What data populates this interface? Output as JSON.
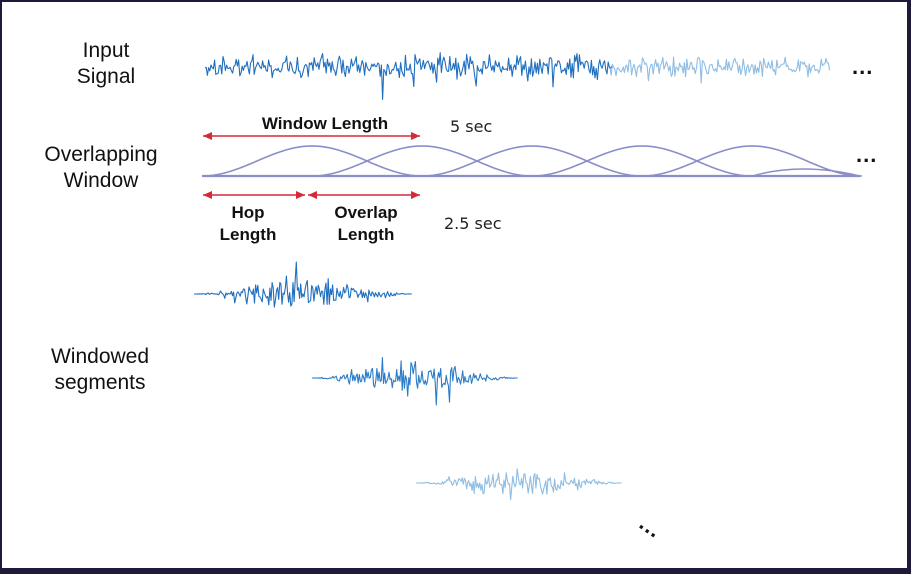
{
  "labels": {
    "input_signal_line1": "Input",
    "input_signal_line2": "Signal",
    "overlapping_window_line1": "Overlapping",
    "overlapping_window_line2": "Window",
    "windowed_segments_line1": "Windowed",
    "windowed_segments_line2": "segments",
    "window_length": "Window Length",
    "hop_length_line1": "Hop",
    "hop_length_line2": "Length",
    "overlap_length_line1": "Overlap",
    "overlap_length_line2": "Length"
  },
  "notes": {
    "window_duration": "5 sec",
    "overlap_duration": "2.5 sec"
  },
  "ellipsis": {
    "signal": "...",
    "window": "...",
    "segments": "..."
  },
  "colors": {
    "signal_dark": "#1f6fbf",
    "signal_light": "#8fbde3",
    "window_curve": "#8a8ec8",
    "arrow": "#d8293a",
    "outer_border": "#1e1b3a"
  }
}
